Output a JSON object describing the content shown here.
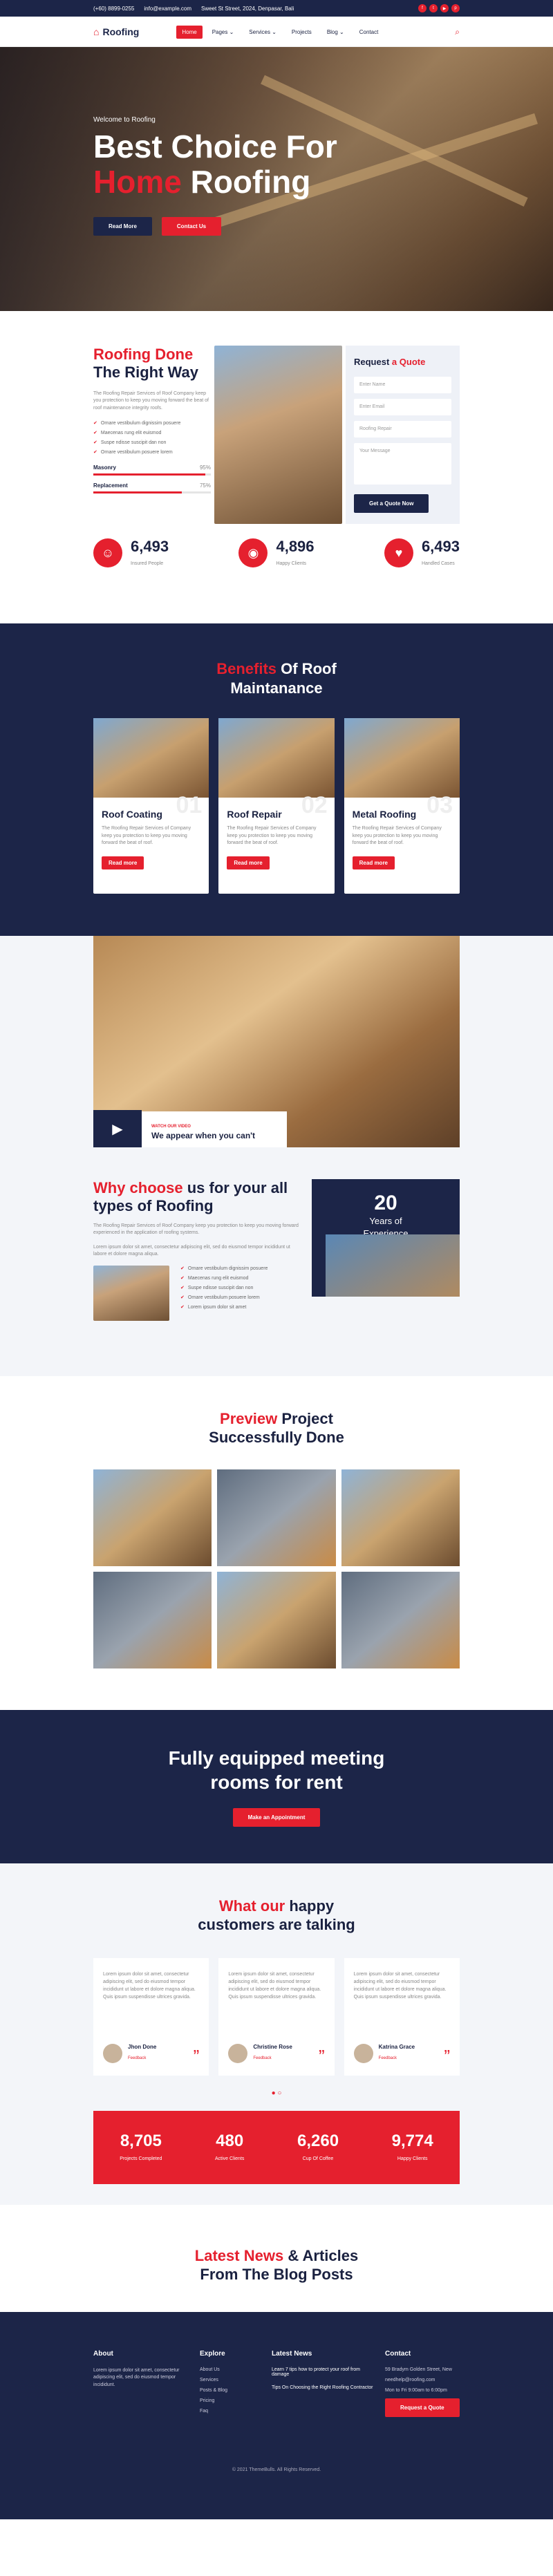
{
  "topbar": {
    "phone": "(+60) 8899-0255",
    "email": "info@example.com",
    "address": "Sweet St Street, 2024, Denpasar, Bali"
  },
  "nav": {
    "logo": "Roofing",
    "items": [
      "Home",
      "Pages ⌄",
      "Services ⌄",
      "Projects",
      "Blog ⌄",
      "Contact"
    ]
  },
  "hero": {
    "pre": "Welcome to Roofing",
    "line1": "Best Choice For",
    "line2_red": "Home",
    "line2": "Roofing",
    "btn1": "Read More",
    "btn2": "Contact Us"
  },
  "about": {
    "title_red": "Roofing Done",
    "title": "The Right Way",
    "text": "The Roofing Repair Services of Roof Company keep you protection to keep you moving forward the beat of roof maintenance integrity roofs.",
    "checks": [
      "Ornare vestibulum dignissim posuere",
      "Maecenas rung elit euismod",
      "Suspe ndisse suscipit dan non",
      "Ornare vestibulum posuere lorem"
    ],
    "p1": "Masonry",
    "p1v": "95%",
    "p1n": 0.95,
    "p2": "Replacement",
    "p2v": "75%",
    "p2n": 0.75
  },
  "quote": {
    "title1": "Request",
    "title2": "a Quote",
    "fields": [
      "Enter Name",
      "Enter Email",
      "Roofing Repair",
      "Your Message"
    ],
    "btn": "Get a Quote Now"
  },
  "stats": [
    {
      "v": "6,493",
      "l": "Insured People"
    },
    {
      "v": "4,896",
      "l": "Happy Clients"
    },
    {
      "v": "6,493",
      "l": "Handled Cases"
    }
  ],
  "benefits": {
    "red": "Benefits",
    "title": "Of Roof",
    "title2": "Maintanance",
    "cards": [
      {
        "n": "01",
        "t": "Roof Coating"
      },
      {
        "n": "02",
        "t": "Roof Repair"
      },
      {
        "n": "03",
        "t": "Metal Roofing"
      }
    ],
    "text": "The Roofing Repair Services of Company keep you protection to keep you moving forward the beat of roof.",
    "btn": "Read more"
  },
  "video": {
    "pre": "WATCH OUR VIDEO",
    "cap": "We appear when you can't"
  },
  "why": {
    "red": "Why choose",
    "title": "us for your all",
    "title2": "types of Roofing",
    "text": "The Roofing Repair Services of Roof Company keep you protection to keep you moving forward experienced in the application of roofing systems.",
    "text2": "Lorem ipsum dolor sit amet, consectetur adipiscing elit, sed do eiusmod tempor incididunt ut labore et dolore magna aliqua.",
    "list": [
      "Ornare vestibulum dignissim posuere",
      "Maecenas rung elit euismod",
      "Suspe ndisse suscipit dan non",
      "Ornare vestibulum posuere lorem",
      "Lorem ipsum dolor sit amet"
    ],
    "years": "20",
    "years_l": "Years of",
    "years_l2": "Experience"
  },
  "projects": {
    "red": "Preview",
    "title": "Project",
    "title2": "Successfully Done"
  },
  "meet": {
    "title": "Fully equipped meeting",
    "title2": "rooms for rent",
    "btn": "Make an Appointment"
  },
  "testimonials": {
    "red": "What our",
    "title": "happy",
    "title2": "customers are talking",
    "text": "Lorem ipsum dolor sit amet, consectetur adipiscing elit, sed do eiusmod tempor incididunt ut labore et dolore magna aliqua. Quis ipsum suspendisse ultrices gravida.",
    "items": [
      {
        "n": "Jhon Done",
        "r": "Feedback"
      },
      {
        "n": "Christine Rose",
        "r": "Feedback"
      },
      {
        "n": "Katrina Grace",
        "r": "Feedback"
      }
    ]
  },
  "counter": [
    {
      "v": "8,705",
      "l": "Projects Completed"
    },
    {
      "v": "480",
      "l": "Active Clients"
    },
    {
      "v": "6,260",
      "l": "Cup Of Coffee"
    },
    {
      "v": "9,774",
      "l": "Happy Clients"
    }
  ],
  "blog": {
    "red": "Latest News",
    "title": "& Articles",
    "title2": "From The Blog Posts"
  },
  "footer": {
    "about": "About",
    "about_text": "Lorem ipsum dolor sit amet, consectetur adipiscing elit, sed do eiusmod tempor incididunt.",
    "explore": "Explore",
    "links": [
      "About Us",
      "Services",
      "Posts & Blog",
      "Pricing",
      "Faq"
    ],
    "news": "Latest News",
    "n1": "Learn 7 tips how to protect your roof from damage",
    "n2": "Tips On Choosing the Right Roofing Contractor",
    "contact": "Contact",
    "c1": "59 Bradym Golden Street, New",
    "c2": "needhelp@roofing.com",
    "c3": "Mon to Fri 9:00am to 6:00pm",
    "btn": "Request a Quote",
    "copy": "© 2021 ThemeBulls. All Rights Reserved."
  }
}
